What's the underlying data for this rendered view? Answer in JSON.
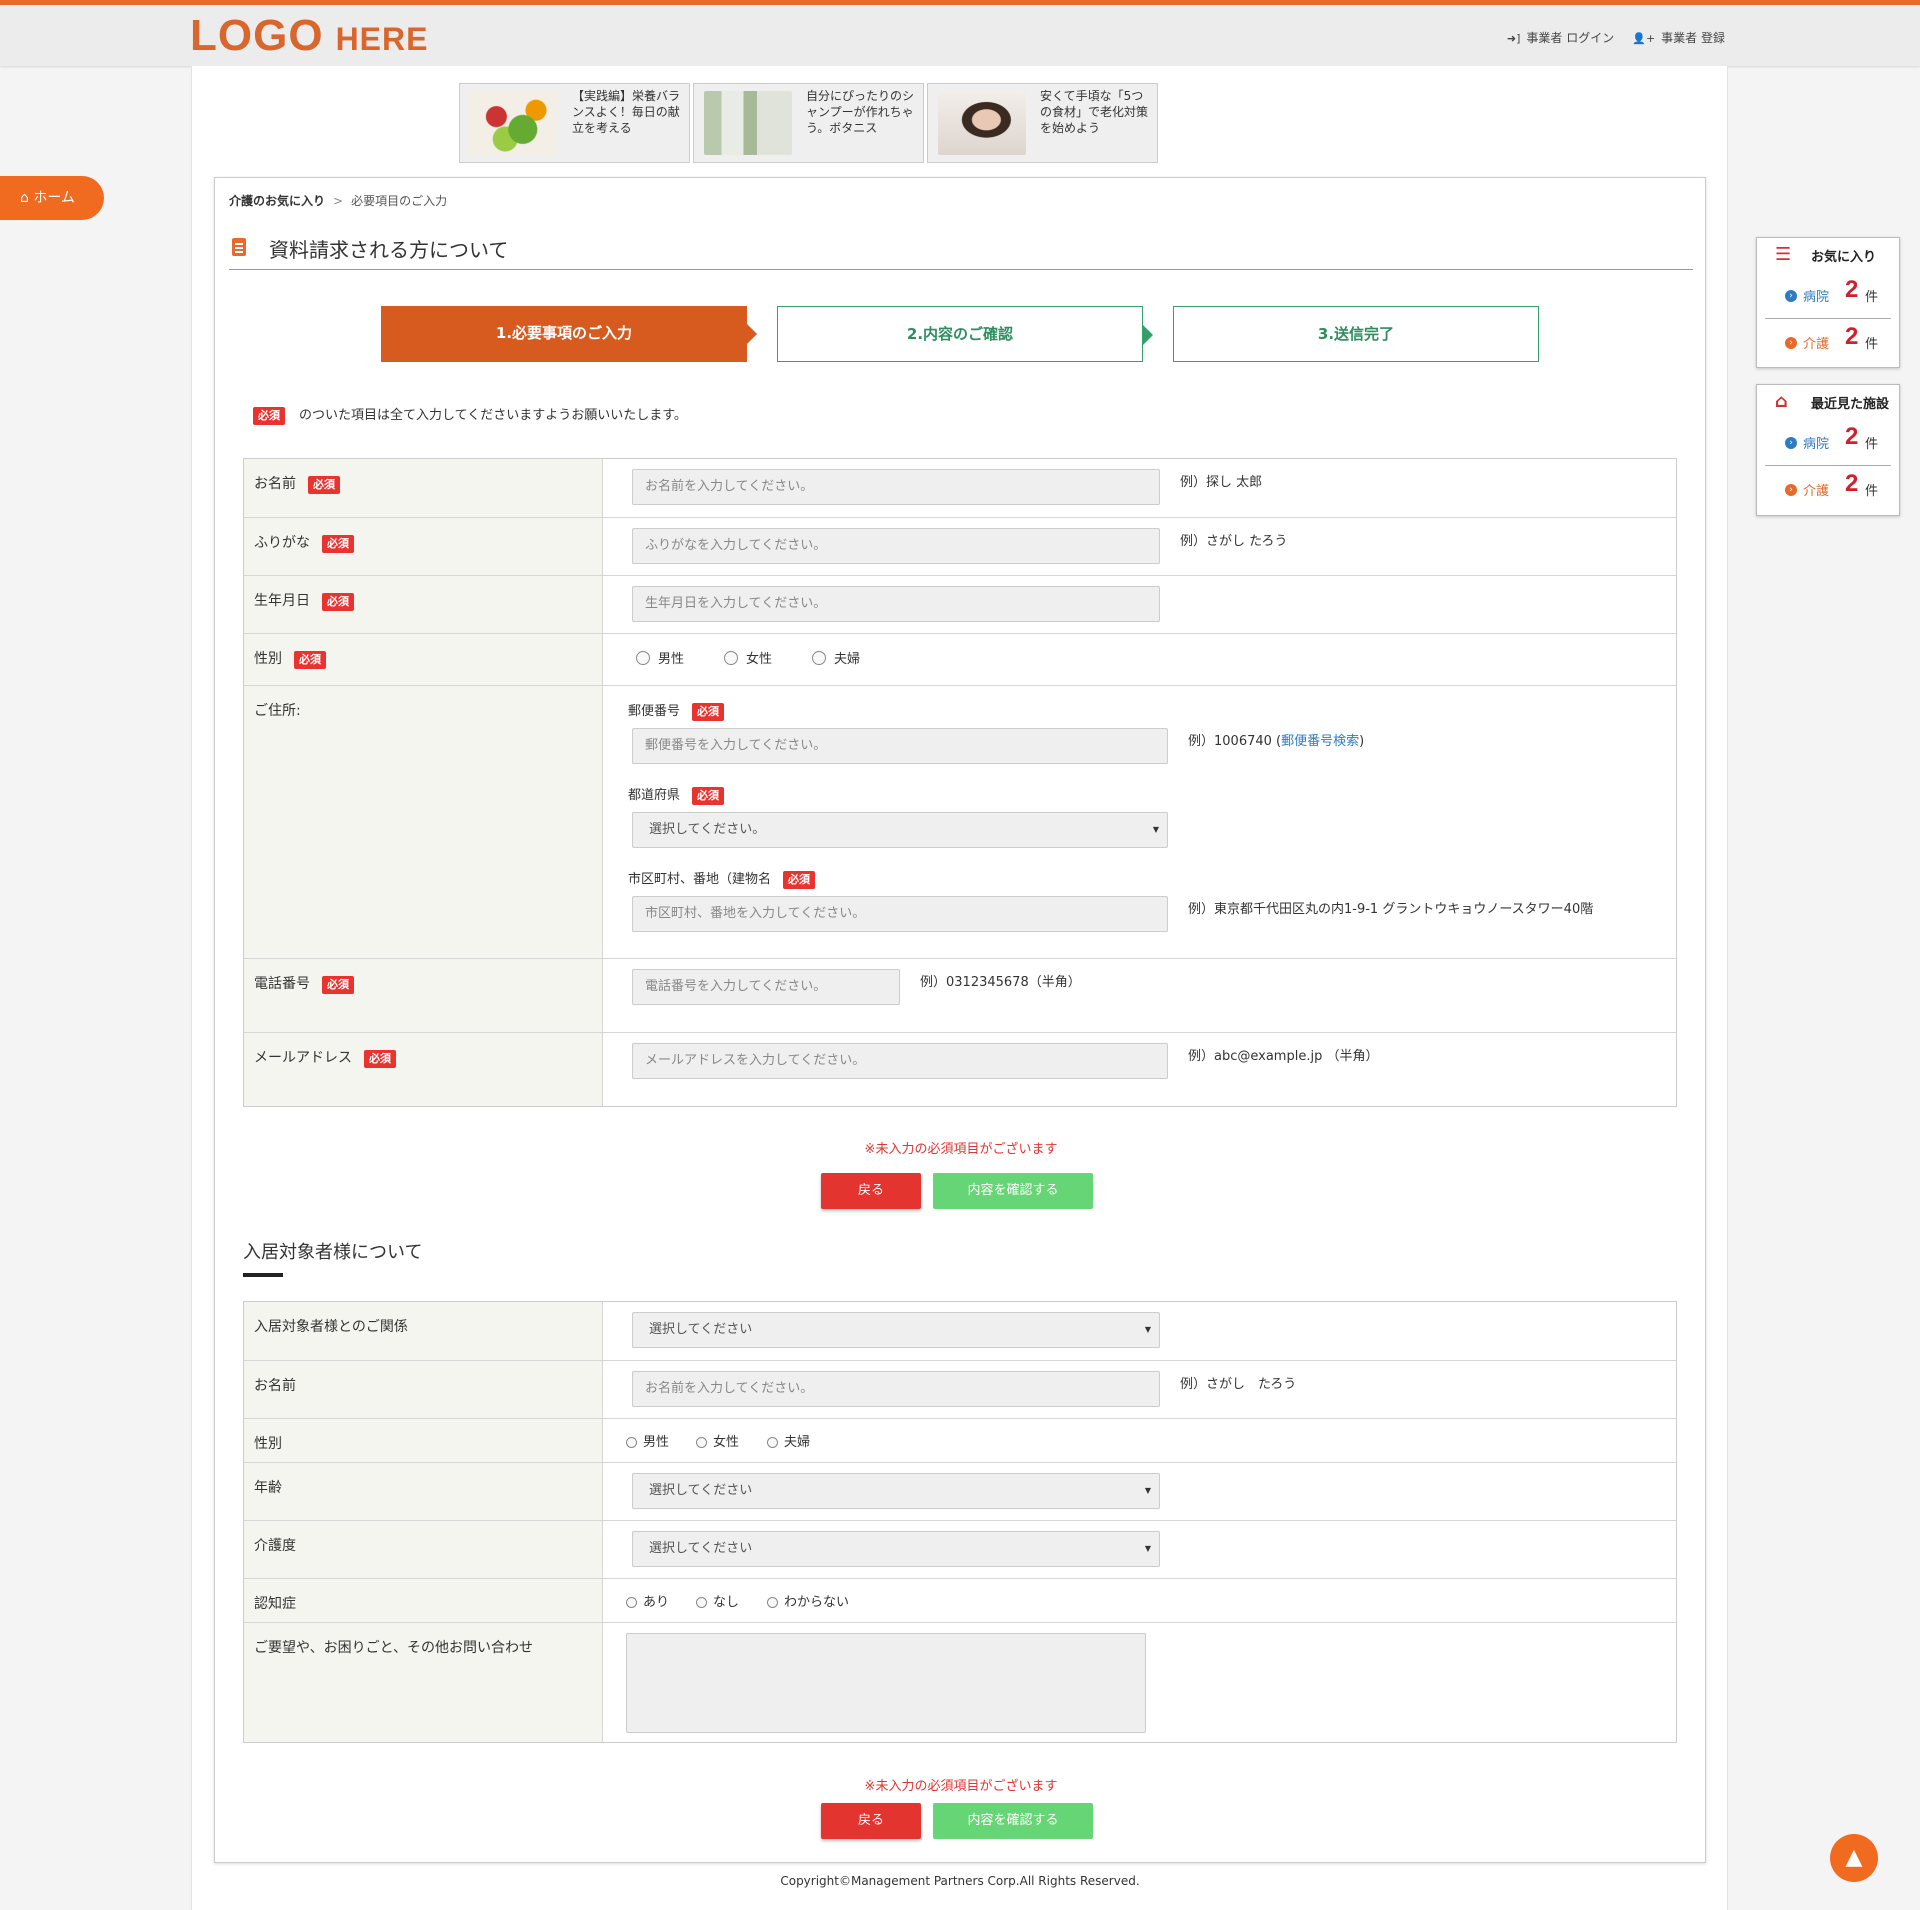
{
  "header": {
    "logo_main": "LOGO",
    "logo_sub": "HERE",
    "login_label": "事業者 ログイン",
    "register_label": "事業者 登録"
  },
  "ads": [
    {
      "text": "【実践編】栄養バランスよく！毎日の献立を考える"
    },
    {
      "text": "自分にぴったりのシャンプーが作れちゃう。ボタニス"
    },
    {
      "text": "安くて手頃な「5つの食材」で老化対策を始めよう"
    }
  ],
  "home_button": "ホーム",
  "breadcrumb": {
    "item1": "介護のお気に入り",
    "sep": ">",
    "item2": "必要項目のご入力"
  },
  "section_title": "資料請求される方について",
  "steps": [
    "1.必要事項のご入力",
    "2.内容のご確認",
    "3.送信完了"
  ],
  "required_label": "必須",
  "required_note": "のついた項目は全て入力してくださいますようお願いいたします。",
  "form1": {
    "name": {
      "label": "お名前",
      "placeholder": "お名前を入力してください。",
      "example": "例）探し 太郎"
    },
    "furigana": {
      "label": "ふりがな",
      "placeholder": "ふりがなを入力してください。",
      "example": "例）さがし たろう"
    },
    "birthday": {
      "label": "生年月日",
      "placeholder": "生年月日を入力してください。"
    },
    "gender": {
      "label": "性別",
      "options": [
        "男性",
        "女性",
        "夫婦"
      ]
    },
    "address": {
      "label": "ご住所:",
      "postal_label": "郵便番号",
      "postal_placeholder": "郵便番号を入力してください。",
      "postal_example_prefix": "例）1006740 (",
      "postal_link": "郵便番号検索",
      "postal_example_suffix": ")",
      "pref_label": "都道府県",
      "pref_selected": "選択してください。",
      "city_label": "市区町村、番地（建物名",
      "city_placeholder": "市区町村、番地を入力してください。",
      "city_example": "例）東京都千代田区丸の内1-9-1 グラントウキョウノースタワー40階"
    },
    "phone": {
      "label": "電話番号",
      "placeholder": "電話番号を入力してください。",
      "example": "例）0312345678（半角）"
    },
    "email": {
      "label": "メールアドレス",
      "placeholder": "メールアドレスを入力してください。",
      "example": "例）abc@example.jp （半角）"
    }
  },
  "error_text": "※未入力の必須項目がございます",
  "buttons": {
    "back": "戻る",
    "confirm": "内容を確認する"
  },
  "section2_title": "入居対象者様について",
  "form2": {
    "relation": {
      "label": "入居対象者様とのご関係",
      "selected": "選択してください"
    },
    "name": {
      "label": "お名前",
      "placeholder": "お名前を入力してください。",
      "example": "例）さがし　たろう"
    },
    "gender": {
      "label": "性別",
      "options": [
        "男性",
        "女性",
        "夫婦"
      ]
    },
    "age": {
      "label": "年齢",
      "selected": "選択してください"
    },
    "care_level": {
      "label": "介護度",
      "selected": "選択してください"
    },
    "dementia": {
      "label": "認知症",
      "options": [
        "あり",
        "なし",
        "わからない"
      ]
    },
    "requests": {
      "label": "ご要望や、お困りごと、その他お問い合わせ"
    }
  },
  "footer": "Copyright©Management Partners Corp.All Rights Reserved.",
  "sidebar": {
    "favorites": {
      "title": "お気に入り",
      "items": [
        {
          "name": "病院",
          "count": "2",
          "unit": "件",
          "color": "#2e7bc4"
        },
        {
          "name": "介護",
          "count": "2",
          "unit": "件",
          "color": "#e8692a"
        }
      ]
    },
    "recent": {
      "title": "最近見た施設",
      "items": [
        {
          "name": "病院",
          "count": "2",
          "unit": "件",
          "color": "#2e7bc4"
        },
        {
          "name": "介護",
          "count": "2",
          "unit": "件",
          "color": "#e8692a"
        }
      ]
    }
  },
  "colors": {
    "accent": "#e8692a",
    "step_active": "#d75a1e",
    "step_border": "#34a06a",
    "required": "#e8332f",
    "confirm": "#66d575"
  }
}
